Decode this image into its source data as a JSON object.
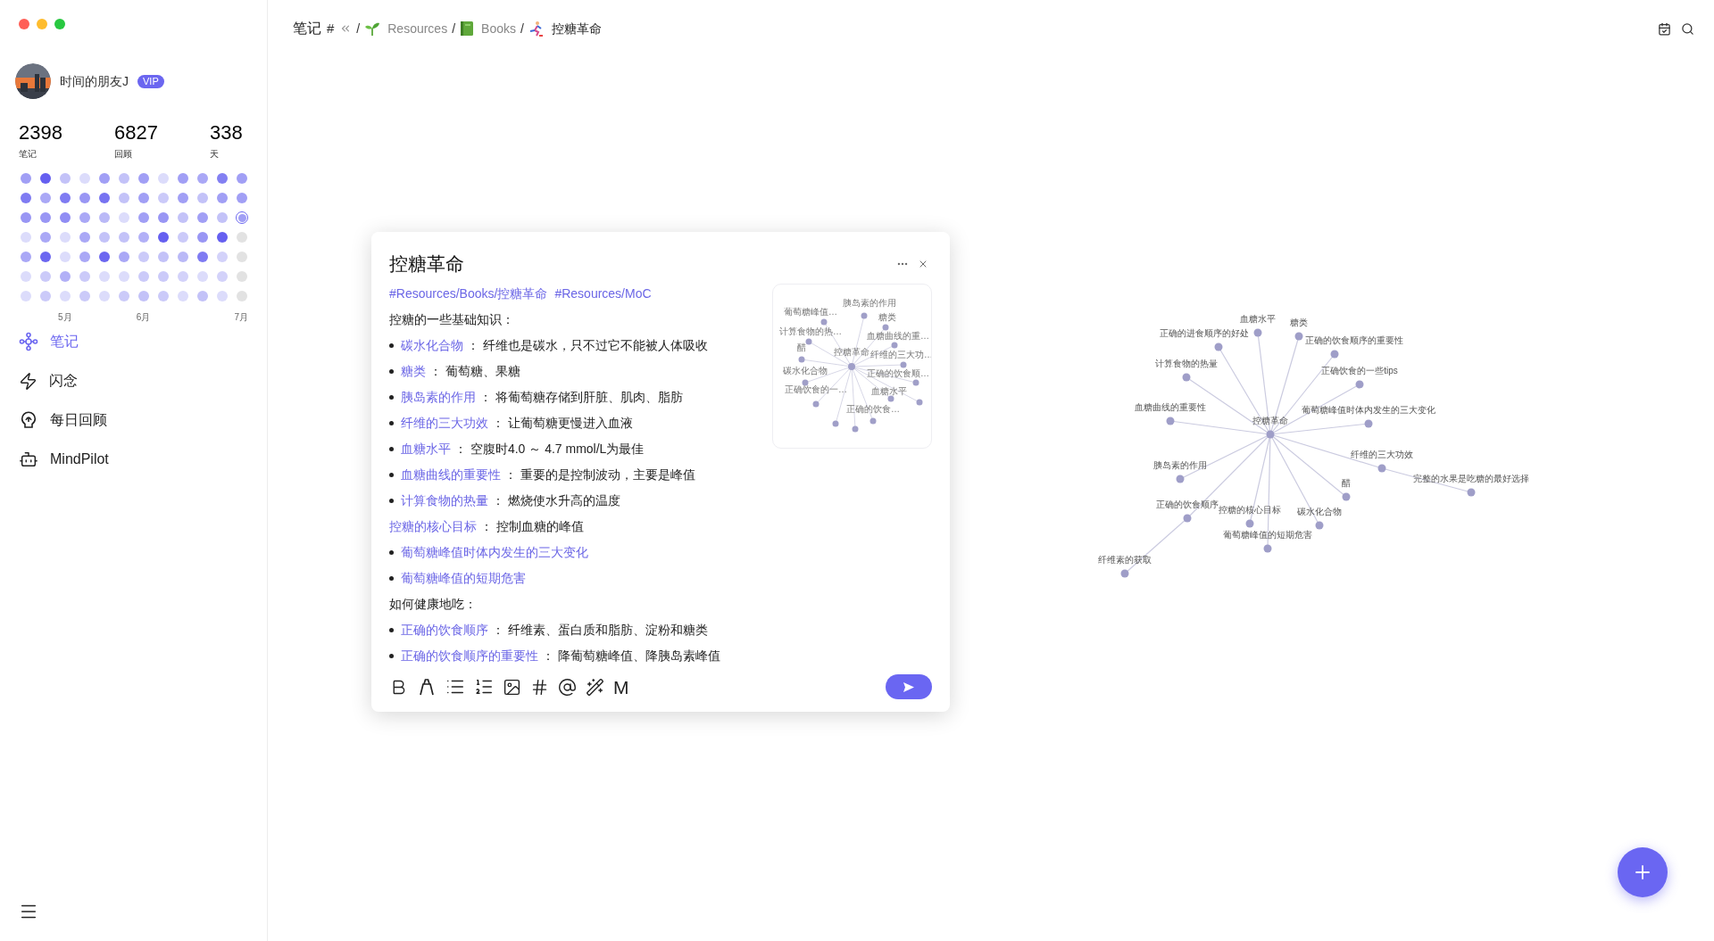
{
  "window": {
    "controls": [
      {
        "kind": "close"
      },
      {
        "kind": "minimize"
      },
      {
        "kind": "zoom"
      }
    ]
  },
  "profile": {
    "name": "时间的朋友J",
    "badge": "VIP"
  },
  "stats": [
    {
      "value": "2398",
      "label": "笔记"
    },
    {
      "value": "6827",
      "label": "回顾"
    },
    {
      "value": "338",
      "label": "天"
    }
  ],
  "heatmap": {
    "rows": [
      {
        "cells": [
          {
            "kind": "day",
            "color": "#a19ff5"
          },
          {
            "kind": "day",
            "color": "#655ff0"
          },
          {
            "kind": "day",
            "color": "#c3c2f8"
          },
          {
            "kind": "day",
            "color": "#dcdcfb"
          },
          {
            "kind": "day",
            "color": "#a19ff5"
          },
          {
            "kind": "day",
            "color": "#c3c2f8"
          },
          {
            "kind": "day",
            "color": "#a19ff5"
          },
          {
            "kind": "day",
            "color": "#dcdcfb"
          },
          {
            "kind": "day",
            "color": "#a19ff5"
          },
          {
            "kind": "day",
            "color": "#aaa8f6"
          },
          {
            "kind": "day",
            "color": "#8380f2"
          },
          {
            "kind": "day",
            "color": "#a19ff5"
          }
        ]
      },
      {
        "cells": [
          {
            "kind": "day",
            "color": "#7f7bf2"
          },
          {
            "kind": "day",
            "color": "#aaa8f6"
          },
          {
            "kind": "day",
            "color": "#7f7bf2"
          },
          {
            "kind": "day",
            "color": "#9996f4"
          },
          {
            "kind": "day",
            "color": "#7773f1"
          },
          {
            "kind": "day",
            "color": "#c3c2f8"
          },
          {
            "kind": "day",
            "color": "#a19ff5"
          },
          {
            "kind": "day",
            "color": "#cbcaf9"
          },
          {
            "kind": "day",
            "color": "#a19ff5"
          },
          {
            "kind": "day",
            "color": "#c3c2f8"
          },
          {
            "kind": "day",
            "color": "#a19ff5"
          },
          {
            "kind": "day",
            "color": "#a19ff5"
          }
        ]
      },
      {
        "cells": [
          {
            "kind": "day",
            "color": "#9996f4"
          },
          {
            "kind": "day",
            "color": "#9996f4"
          },
          {
            "kind": "day",
            "color": "#908df4"
          },
          {
            "kind": "day",
            "color": "#aaa8f6"
          },
          {
            "kind": "day",
            "color": "#bab9f7"
          },
          {
            "kind": "day",
            "color": "#dcdcfb"
          },
          {
            "kind": "day",
            "color": "#a19ff5"
          },
          {
            "kind": "day",
            "color": "#9996f4"
          },
          {
            "kind": "day",
            "color": "#c3c2f8"
          },
          {
            "kind": "day",
            "color": "#a19ff5"
          },
          {
            "kind": "day",
            "color": "#c3c2f8"
          },
          {
            "kind": "today",
            "color": "#a19ff5"
          }
        ]
      },
      {
        "cells": [
          {
            "kind": "day",
            "color": "#dcdcfb"
          },
          {
            "kind": "day",
            "color": "#aaa8f6"
          },
          {
            "kind": "day",
            "color": "#dcdcfb"
          },
          {
            "kind": "day",
            "color": "#aaa8f6"
          },
          {
            "kind": "day",
            "color": "#c3c2f8"
          },
          {
            "kind": "day",
            "color": "#c3c2f8"
          },
          {
            "kind": "day",
            "color": "#b2b0f7"
          },
          {
            "kind": "day",
            "color": "#655ff0"
          },
          {
            "kind": "day",
            "color": "#cbcaf9"
          },
          {
            "kind": "day",
            "color": "#9996f4"
          },
          {
            "kind": "day",
            "color": "#655ff0"
          },
          {
            "kind": "future",
            "color": "#e2e2e2"
          }
        ]
      },
      {
        "cells": [
          {
            "kind": "day",
            "color": "#aaa8f6"
          },
          {
            "kind": "day",
            "color": "#6c67f0"
          },
          {
            "kind": "day",
            "color": "#dcdcfb"
          },
          {
            "kind": "day",
            "color": "#aaa8f6"
          },
          {
            "kind": "day",
            "color": "#6c67f0"
          },
          {
            "kind": "day",
            "color": "#aaa8f6"
          },
          {
            "kind": "day",
            "color": "#cbcaf9"
          },
          {
            "kind": "day",
            "color": "#c3c2f8"
          },
          {
            "kind": "day",
            "color": "#bab9f7"
          },
          {
            "kind": "day",
            "color": "#7f7bf2"
          },
          {
            "kind": "day",
            "color": "#d3d2fa"
          },
          {
            "kind": "future",
            "color": "#e2e2e2"
          }
        ]
      },
      {
        "cells": [
          {
            "kind": "day",
            "color": "#dcdcfb"
          },
          {
            "kind": "day",
            "color": "#cbcaf9"
          },
          {
            "kind": "day",
            "color": "#b2b0f7"
          },
          {
            "kind": "day",
            "color": "#cbcaf9"
          },
          {
            "kind": "day",
            "color": "#dcdcfb"
          },
          {
            "kind": "day",
            "color": "#dcdcfb"
          },
          {
            "kind": "day",
            "color": "#cbcaf9"
          },
          {
            "kind": "day",
            "color": "#cbcaf9"
          },
          {
            "kind": "day",
            "color": "#d3d2fa"
          },
          {
            "kind": "day",
            "color": "#dcdcfb"
          },
          {
            "kind": "day",
            "color": "#d3d2fa"
          },
          {
            "kind": "future",
            "color": "#e2e2e2"
          }
        ]
      },
      {
        "cells": [
          {
            "kind": "day",
            "color": "#dcdcfb"
          },
          {
            "kind": "day",
            "color": "#cbcaf9"
          },
          {
            "kind": "day",
            "color": "#dcdcfb"
          },
          {
            "kind": "day",
            "color": "#cbcaf9"
          },
          {
            "kind": "day",
            "color": "#dcdcfb"
          },
          {
            "kind": "day",
            "color": "#cbcaf9"
          },
          {
            "kind": "day",
            "color": "#c3c2f8"
          },
          {
            "kind": "day",
            "color": "#cbcaf9"
          },
          {
            "kind": "day",
            "color": "#dcdcfb"
          },
          {
            "kind": "day",
            "color": "#c3c2f8"
          },
          {
            "kind": "day",
            "color": "#dcdcfb"
          },
          {
            "kind": "future",
            "color": "#e2e2e2"
          }
        ]
      }
    ],
    "months": [
      "5月",
      "6月",
      "7月"
    ]
  },
  "nav": [
    {
      "label": "笔记",
      "selected": true
    },
    {
      "label": "闪念",
      "selected": false
    },
    {
      "label": "每日回顾",
      "selected": false
    },
    {
      "label": "MindPilot",
      "selected": false
    }
  ],
  "breadcrumb": {
    "root": "笔记",
    "hash": "#",
    "items": [
      {
        "sep": "/",
        "label": "Resources",
        "current": false
      },
      {
        "sep": "/",
        "label": "Books",
        "current": false
      },
      {
        "sep": "/",
        "label": "控糖革命",
        "current": true
      }
    ]
  },
  "note": {
    "title": "控糖革命",
    "tags": [
      "#Resources/Books/控糖革命",
      "#Resources/MoC"
    ],
    "body": [
      {
        "kind": "plain",
        "text": "控糖的一些基础知识："
      },
      {
        "kind": "bullet",
        "link": "碳水化合物",
        "text": "：  纤维也是碳水，只不过它不能被人体吸收"
      },
      {
        "kind": "bullet",
        "link": "糖类",
        "text": "：  葡萄糖、果糖"
      },
      {
        "kind": "bullet",
        "link": "胰岛素的作用",
        "text": "：  将葡萄糖存储到肝脏、肌肉、脂肪"
      },
      {
        "kind": "bullet",
        "link": "纤维的三大功效",
        "text": "：  让葡萄糖更慢进入血液"
      },
      {
        "kind": "bullet",
        "link": "血糖水平",
        "text": "：  空腹时4.0 ～ 4.7 mmol/L为最佳"
      },
      {
        "kind": "bullet",
        "link": "血糖曲线的重要性",
        "text": "：  重要的是控制波动，主要是峰值"
      },
      {
        "kind": "bullet",
        "link": "计算食物的热量",
        "text": "：  燃烧使水升高的温度"
      },
      {
        "kind": "line",
        "link": "控糖的核心目标",
        "text": "：  控制血糖的峰值"
      },
      {
        "kind": "bullet",
        "link": "葡萄糖峰值时体内发生的三大变化"
      },
      {
        "kind": "bullet",
        "link": "葡萄糖峰值的短期危害"
      },
      {
        "kind": "plain",
        "text": "如何健康地吃："
      },
      {
        "kind": "bullet",
        "link": "正确的饮食顺序",
        "text": "：  纤维素、蛋白质和脂肪、淀粉和糖类"
      },
      {
        "kind": "bullet",
        "link": "正确的饮食顺序的重要性",
        "text": "：  降葡萄糖峰值、降胰岛素峰值"
      }
    ],
    "markdown_button": "M",
    "mini_graph": {
      "center": "控糖革命",
      "nodes": [
        {
          "label": "胰岛素的作用"
        },
        {
          "label": "葡萄糖峰值…"
        },
        {
          "label": "糖类"
        },
        {
          "label": "计算食物的热…"
        },
        {
          "label": "血糖曲线的重…"
        },
        {
          "label": "醋"
        },
        {
          "label": "纤维的三大功…"
        },
        {
          "label": "碳水化合物"
        },
        {
          "label": "正确的饮食顺…"
        },
        {
          "label": "正确饮食的一…"
        },
        {
          "label": "血糖水平"
        },
        {
          "label": "正确的饮食…"
        }
      ]
    }
  },
  "graph": {
    "center": "控糖革命",
    "children": [
      {
        "label": "血糖水平"
      },
      {
        "label": "糖类"
      },
      {
        "label": "正确的进食顺序的好处"
      },
      {
        "label": "正确的饮食顺序的重要性"
      },
      {
        "label": "计算食物的热量"
      },
      {
        "label": "正确饮食的一些tips"
      },
      {
        "label": "血糖曲线的重要性"
      },
      {
        "label": "葡萄糖峰值时体内发生的三大变化"
      },
      {
        "label": "胰岛素的作用"
      },
      {
        "label": "纤维的三大功效",
        "children": [
          {
            "label": "完整的水果是吃糖的最好选择"
          }
        ]
      },
      {
        "label": "醋"
      },
      {
        "label": "正确的饮食顺序",
        "children": [
          {
            "label": "纤维素的获取"
          }
        ]
      },
      {
        "label": "控糖的核心目标"
      },
      {
        "label": "碳水化合物"
      },
      {
        "label": "葡萄糖峰值的短期危害"
      }
    ]
  }
}
